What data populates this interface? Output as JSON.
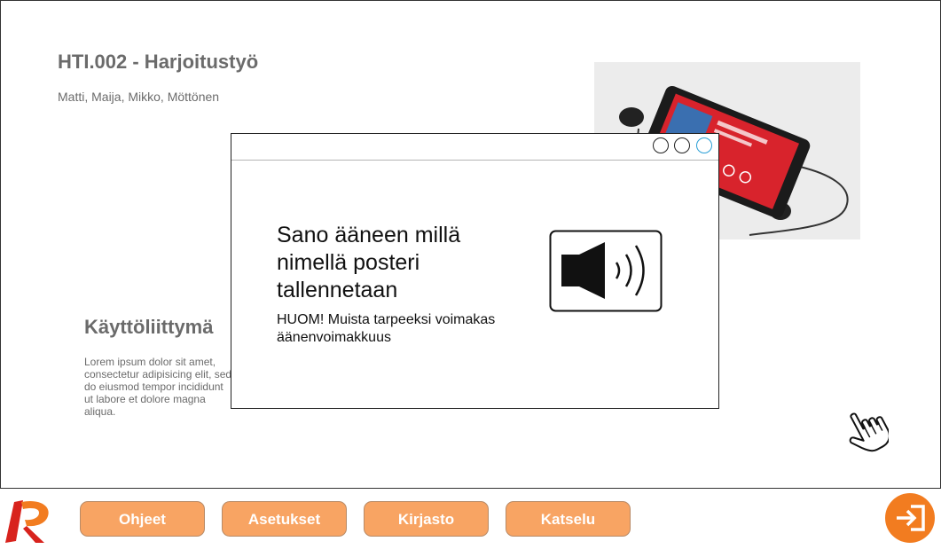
{
  "header": {
    "title": "HTI.002 - Harjoitustyö",
    "authors": "Matti, Maija, Mikko, Möttönen"
  },
  "section": {
    "title": "Käyttöliittymä",
    "body": "Lorem ipsum dolor sit amet, consectetur adipisicing elit, sed do eiusmod tempor incididunt ut labore et dolore magna aliqua."
  },
  "dialog": {
    "prompt": "Sano ääneen millä nimellä posteri tallennetaan",
    "note": "HUOM! Muista tarpeeksi voimakas äänenvoimakkuus"
  },
  "nav": {
    "buttons": [
      "Ohjeet",
      "Asetukset",
      "Kirjasto",
      "Katselu"
    ]
  },
  "icons": {
    "speaker": "speaker-volume-icon",
    "cursor": "hand-pointer-icon",
    "logo": "app-logo",
    "exit": "exit-icon"
  },
  "colors": {
    "accent": "#f8a463",
    "logo_red": "#d8231d",
    "exit_orange": "#f27c20",
    "phone_red": "#d8232c",
    "text_gray": "#6b6b6b",
    "window_button_active": "#2a9fd6"
  }
}
